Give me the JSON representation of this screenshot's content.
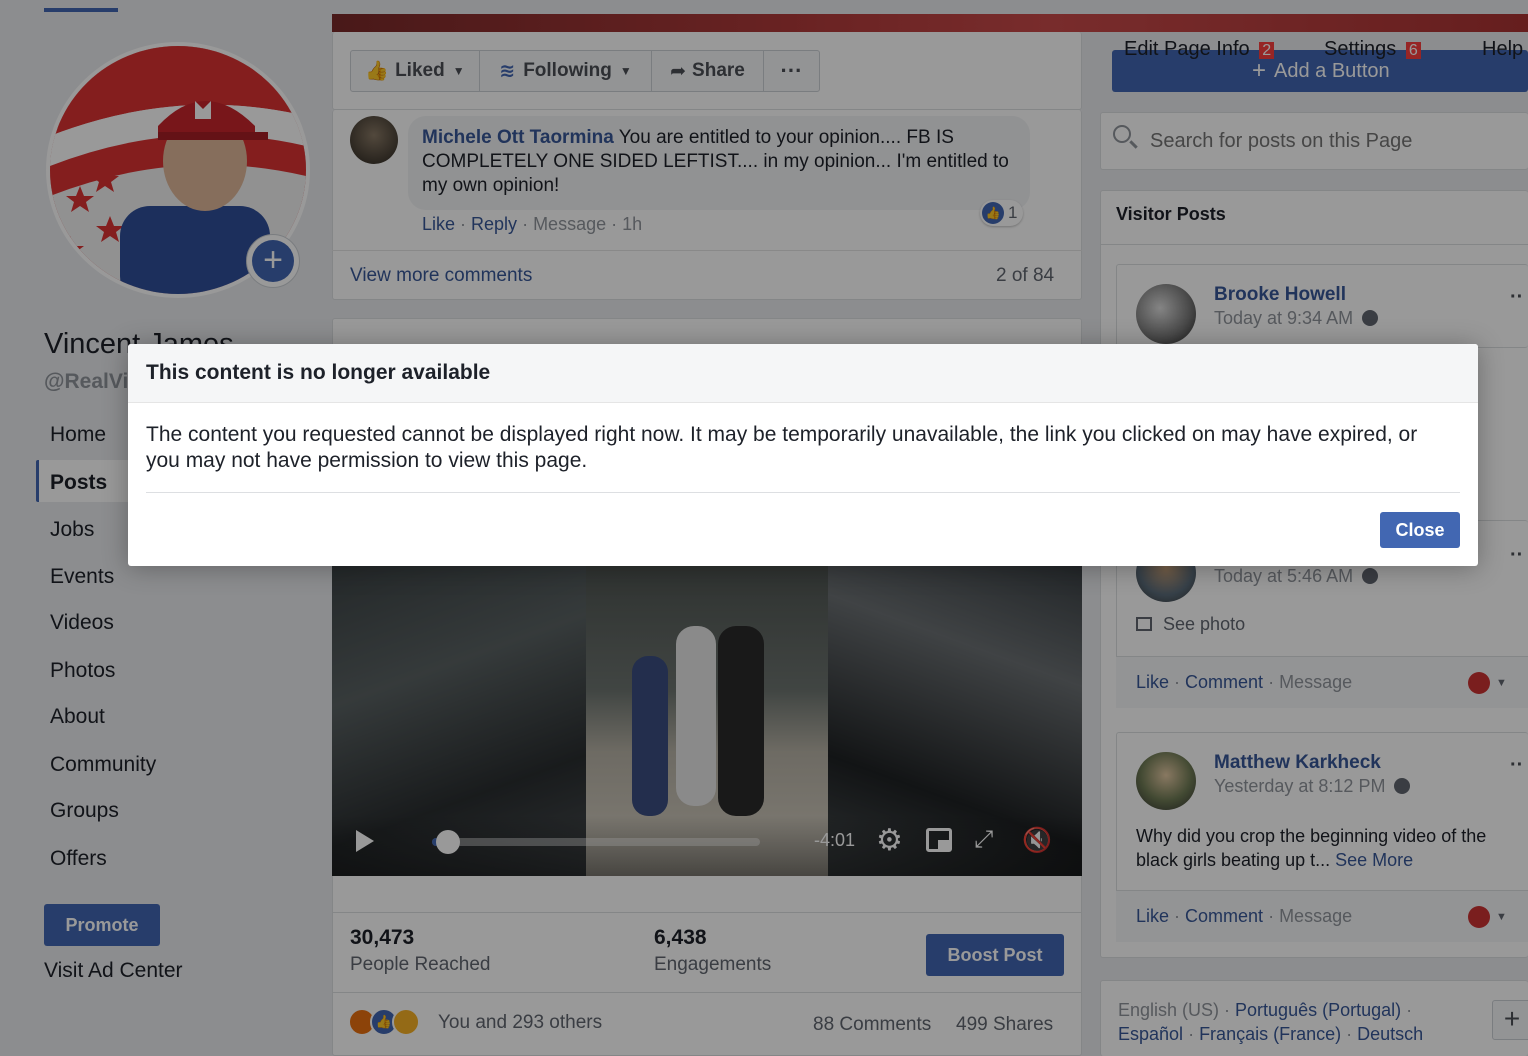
{
  "top_tabs": {
    "edit_page_info": "Edit Page Info",
    "edit_page_info_count": "2",
    "settings": "Settings",
    "settings_count": "6",
    "help": "Help",
    "add_button": "Add a Button"
  },
  "page": {
    "name": "Vincent James",
    "handle": "@RealVi"
  },
  "left_nav": {
    "items": [
      "Home",
      "Posts",
      "Jobs",
      "Events",
      "Videos",
      "Photos",
      "About",
      "Community",
      "Groups",
      "Offers"
    ],
    "promote": "Promote",
    "visit_ad_center": "Visit Ad Center"
  },
  "post_actions": {
    "liked": "Liked",
    "following": "Following",
    "share": "Share",
    "more": "···"
  },
  "comment": {
    "author": "Michele Ott Taormina",
    "text": "You are entitled to your opinion.... FB IS COMPLETELY ONE SIDED LEFTIST.... in my opinion... I'm entitled to my own opinion!",
    "reaction_count": "1",
    "like": "Like",
    "reply": "Reply",
    "message": "Message",
    "time": "1h"
  },
  "comments_footer": {
    "view_more": "View more comments",
    "pager": "2 of 84"
  },
  "video": {
    "time_remaining": "-4:01",
    "progress": 0.03
  },
  "insights": {
    "reached_value": "30,473",
    "reached_label": "People Reached",
    "engagements_value": "6,438",
    "engagements_label": "Engagements",
    "boost": "Boost Post"
  },
  "reactions_bar": {
    "summary": "You and 293 others",
    "comments": "88 Comments",
    "shares": "499 Shares"
  },
  "search": {
    "placeholder": "Search for posts on this Page"
  },
  "visitor_posts": {
    "title": "Visitor Posts",
    "posts": [
      {
        "author": "Brooke Howell",
        "time": "Today at 9:34 AM"
      },
      {
        "author": "",
        "time": "Today at 5:46 AM",
        "see_photo": "See photo",
        "like": "Like",
        "comment": "Comment",
        "message": "Message"
      },
      {
        "author": "Matthew Karkheck",
        "time": "Yesterday at 8:12 PM",
        "text": "Why did you crop the beginning video of the black girls beating up t...",
        "see_more": "See More",
        "like": "Like",
        "comment": "Comment",
        "message": "Message"
      }
    ]
  },
  "languages": {
    "line1_a": "English (US)",
    "line1_b": "Português (Portugal)",
    "line2_a": "Español",
    "line2_b": "Français (France)",
    "line2_c": "Deutsch"
  },
  "dialog": {
    "title": "This content is no longer available",
    "body": "The content you requested cannot be displayed right now. It may be temporarily unavailable, the link you clicked on may have expired, or you may not have permission to view this page.",
    "close": "Close"
  },
  "colors": {
    "fb_blue": "#4267b2",
    "link": "#385898",
    "badge_red": "#fa3e3e",
    "overlay": "rgba(0,0,0,0.40)"
  }
}
